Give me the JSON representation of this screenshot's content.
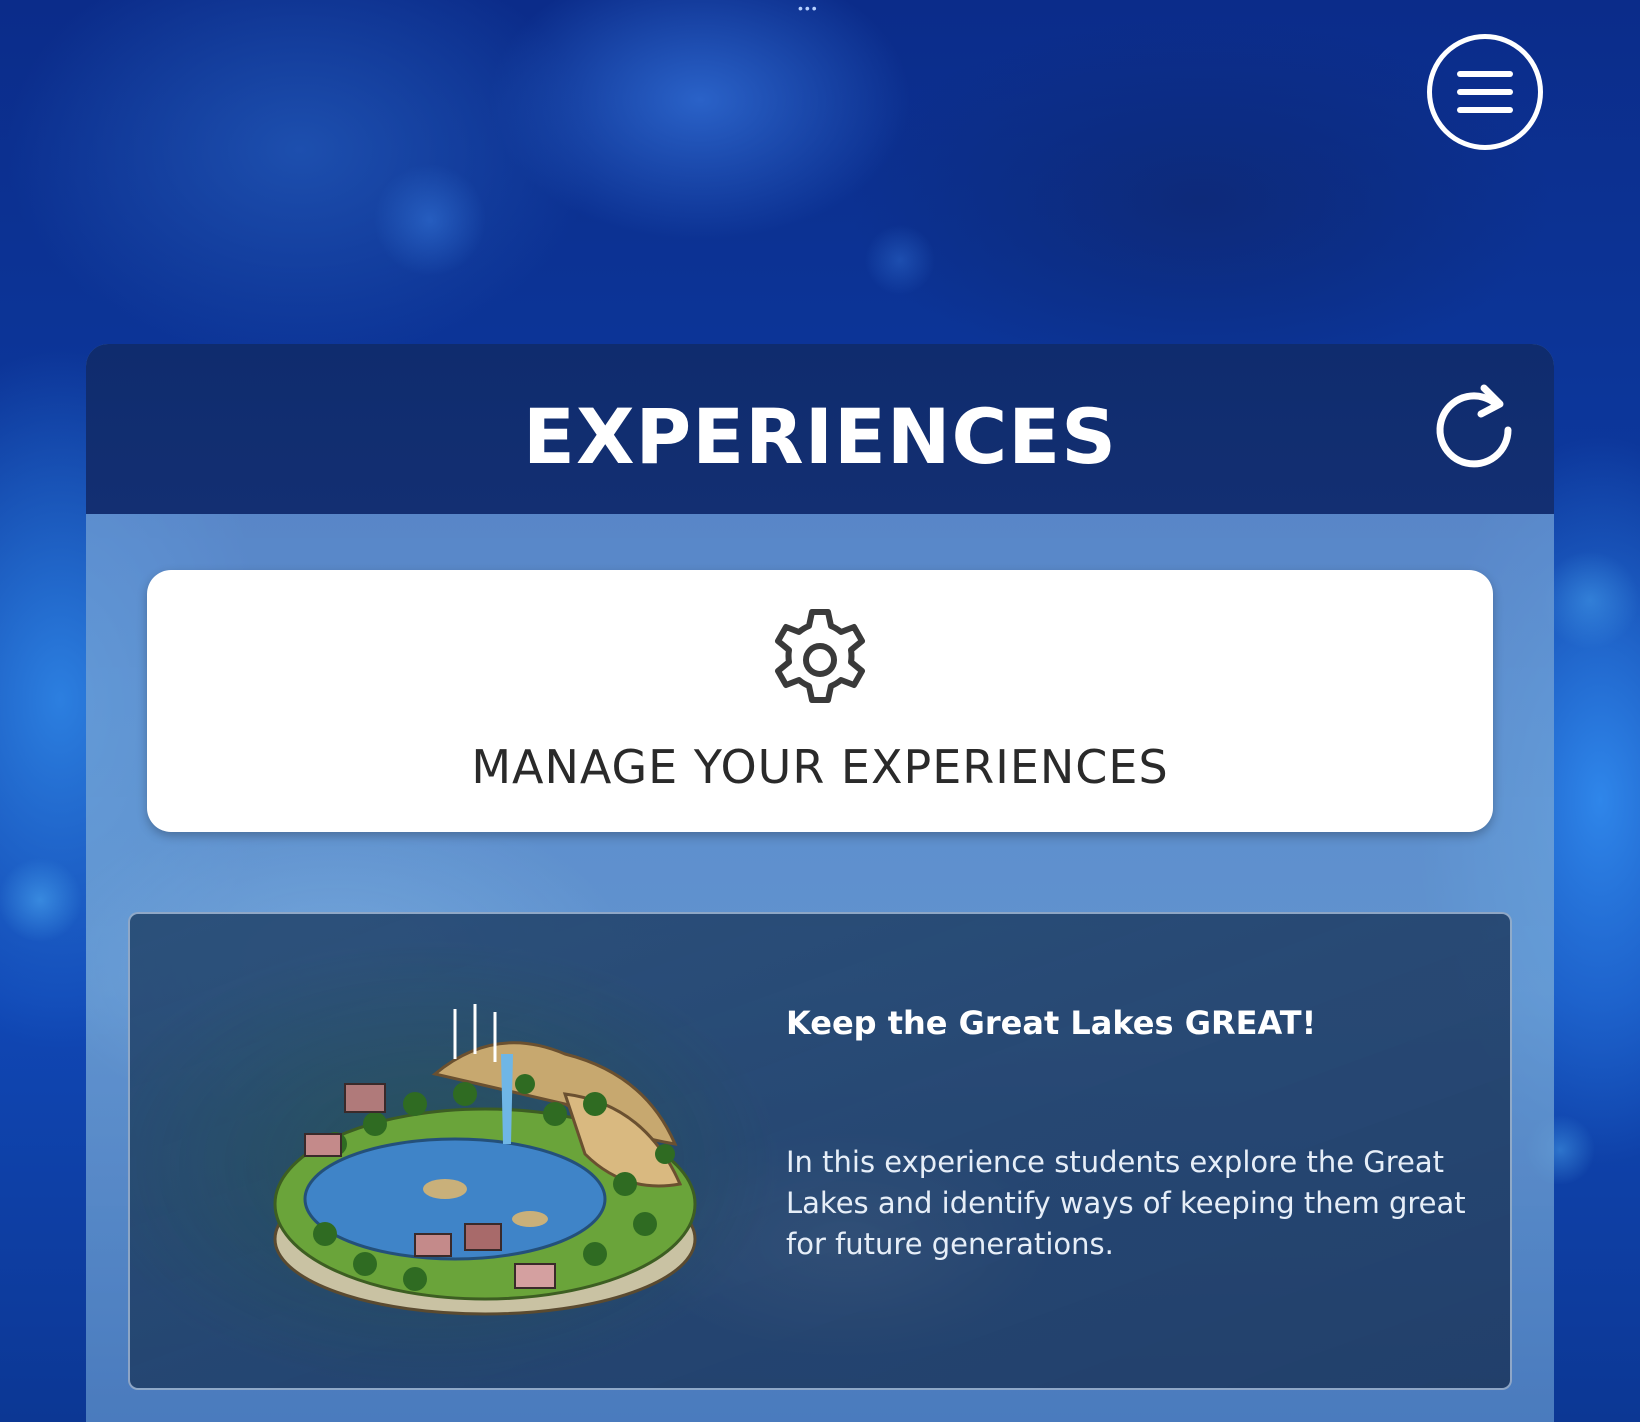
{
  "app": {
    "menu_icon": "hamburger-menu-icon"
  },
  "header": {
    "title": "EXPERIENCES",
    "refresh_icon": "refresh-icon"
  },
  "manage": {
    "icon": "gear-icon",
    "label": "MANAGE YOUR EXPERIENCES"
  },
  "experiences": [
    {
      "title": "Keep the Great Lakes GREAT!",
      "description": "In this experience students explore the Great Lakes and identify ways of keeping them great for future generations.",
      "thumbnail_icon": "island-landscape-image"
    }
  ],
  "colors": {
    "header_bg": "#132f72",
    "card_bg": "#ffffff",
    "text_dark": "#2a2a2a",
    "text_light": "#ffffff"
  }
}
